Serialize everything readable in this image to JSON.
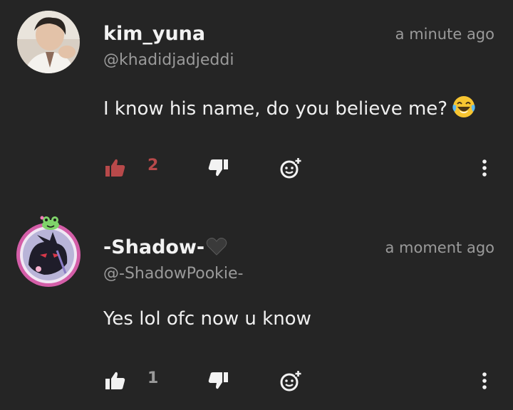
{
  "comments": [
    {
      "username": "kim_yuna",
      "handle": "@khadidjadjeddi",
      "time": "a minute ago",
      "text": "I know his name, do you believe me?",
      "emoji": "laughing-tears-emoji",
      "likes": "2",
      "liked": true,
      "like_color": "#b7494a"
    },
    {
      "username": "-Shadow-",
      "username_emoji": "black-heart-emoji",
      "handle": "@-ShadowPookie-",
      "time": "a moment ago",
      "text": "Yes lol ofc now u know",
      "likes": "1",
      "liked": false,
      "like_color": "#f2f2f2"
    }
  ],
  "icons": {
    "like": "thumbs-up-icon",
    "dislike": "thumbs-down-icon",
    "react": "add-reaction-icon",
    "more": "more-vertical-icon"
  },
  "colors": {
    "background": "#252525",
    "primary_text": "#f2f2f2",
    "secondary_text": "#9a9a9a",
    "liked_accent": "#b7494a",
    "unliked_count": "#9a9a9a"
  }
}
